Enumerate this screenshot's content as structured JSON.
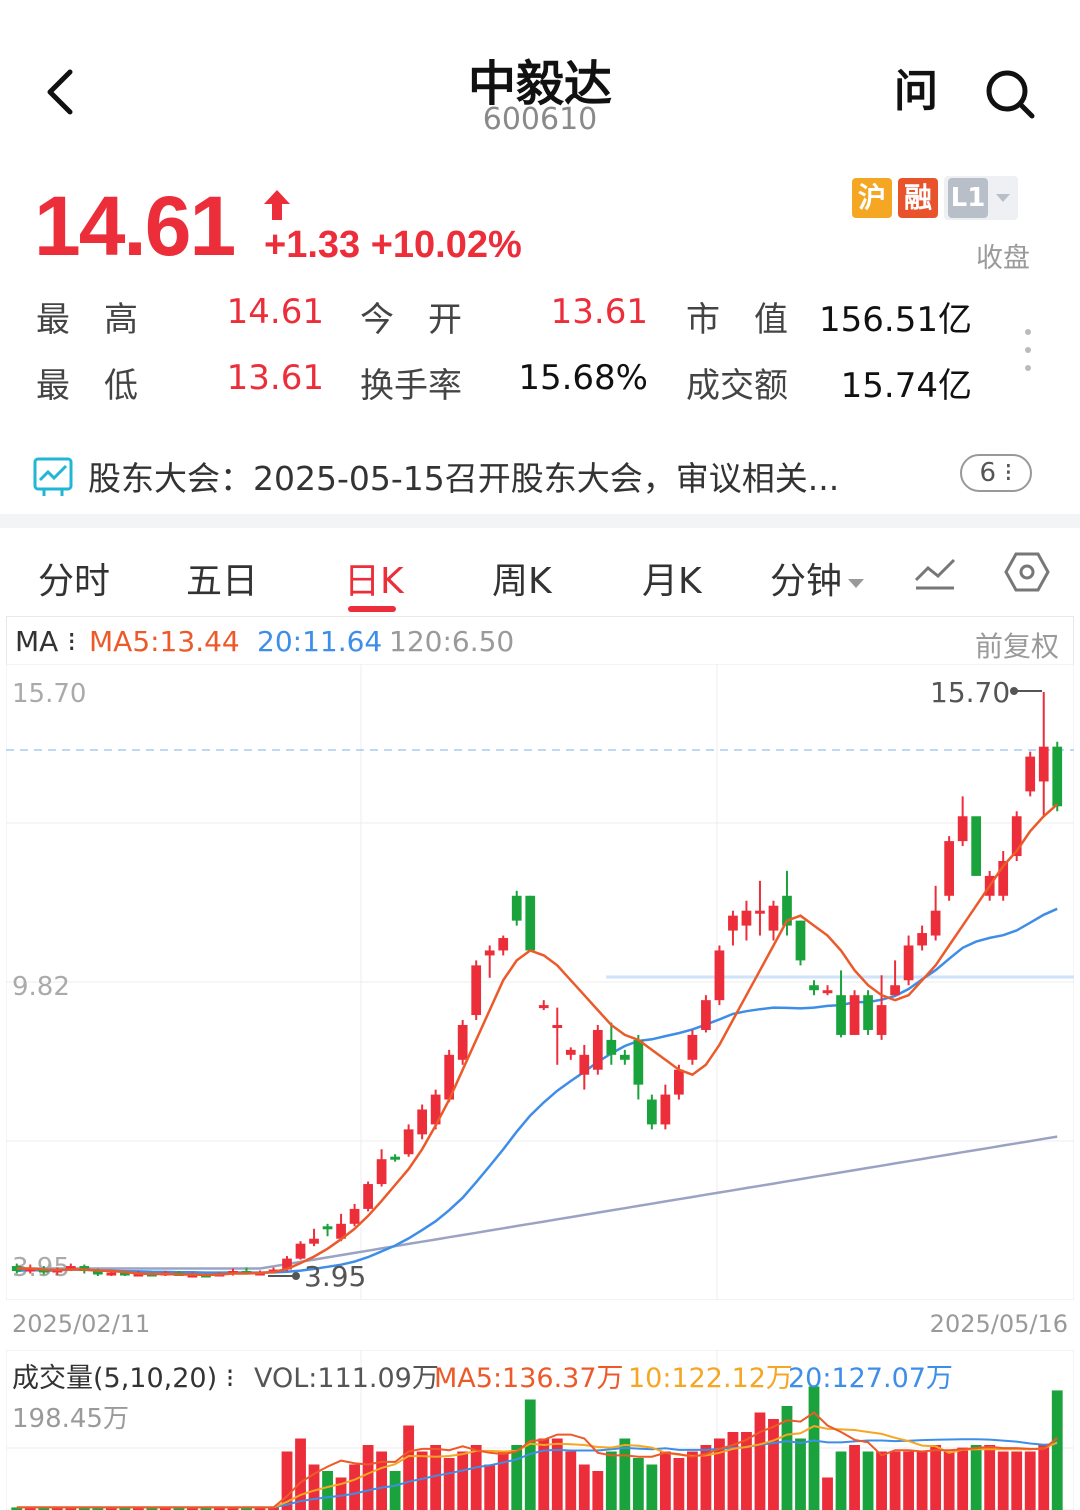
{
  "header": {
    "title": "中毅达",
    "code": "600610",
    "ask_label": "问"
  },
  "quote": {
    "price": "14.61",
    "change": "+1.33 +10.02%",
    "status": "收盘",
    "badges": {
      "hu": "沪",
      "rong": "融",
      "l1": "L1"
    },
    "stats": {
      "high_label": "最　高",
      "high_value": "14.61",
      "open_label": "今　开",
      "open_value": "13.61",
      "mcap_label": "市　值",
      "mcap_value": "156.51亿",
      "low_label": "最　低",
      "low_value": "13.61",
      "turnover_label": "换手率",
      "turnover_value": "15.68%",
      "amount_label": "成交额",
      "amount_value": "15.74亿"
    }
  },
  "notice": {
    "text": "股东大会：2025-05-15召开股东大会，审议相关...",
    "count": "6"
  },
  "tabs": [
    {
      "label": "分时"
    },
    {
      "label": "五日"
    },
    {
      "label": "日K"
    },
    {
      "label": "周K"
    },
    {
      "label": "月K"
    },
    {
      "label": "分钟"
    }
  ],
  "ma_bar": {
    "prefix": "MA",
    "ma5": "MA5:13.44",
    "ma20": "20:11.64",
    "ma120": "120:6.50",
    "adjust": "前复权"
  },
  "colors": {
    "up": "#ec2d3a",
    "down": "#1aa33c",
    "ma5": "#ec5a2a",
    "ma20": "#3e8ee8",
    "ma120": "#9aa3c4",
    "vol10": "#f5a623"
  },
  "chart_data": {
    "type": "candlestick",
    "y_axis_labels": [
      "15.70",
      "9.82",
      "3.95"
    ],
    "ylim": [
      3.95,
      15.7
    ],
    "max_annotation": "15.70",
    "min_annotation": "3.95",
    "x_start": "2025/02/11",
    "x_end": "2025/05/16",
    "candles": [
      [
        4.15,
        4.05,
        4.2,
        4.0
      ],
      [
        4.05,
        4.1,
        4.18,
        4.0
      ],
      [
        4.1,
        4.02,
        4.15,
        3.98
      ],
      [
        4.02,
        4.08,
        4.12,
        3.97
      ],
      [
        4.08,
        4.15,
        4.2,
        4.05
      ],
      [
        4.15,
        4.05,
        4.18,
        4.0
      ],
      [
        4.05,
        3.98,
        4.1,
        3.95
      ],
      [
        3.98,
        4.02,
        4.08,
        3.95
      ],
      [
        4.02,
        3.97,
        4.05,
        3.95
      ],
      [
        3.97,
        4.0,
        4.05,
        3.95
      ],
      [
        4.0,
        3.96,
        4.02,
        3.95
      ],
      [
        3.96,
        4.02,
        4.05,
        3.95
      ],
      [
        4.02,
        3.95,
        4.05,
        3.95
      ],
      [
        3.95,
        3.98,
        4.02,
        3.95
      ],
      [
        3.98,
        3.96,
        4.0,
        3.95
      ],
      [
        3.96,
        4.0,
        4.02,
        3.95
      ],
      [
        4.0,
        4.05,
        4.1,
        3.96
      ],
      [
        4.05,
        4.0,
        4.12,
        3.98
      ],
      [
        4.0,
        4.02,
        4.06,
        3.97
      ],
      [
        4.02,
        4.08,
        4.12,
        4.0
      ],
      [
        4.08,
        4.3,
        4.35,
        4.05
      ],
      [
        4.3,
        4.6,
        4.65,
        4.28
      ],
      [
        4.6,
        4.7,
        4.9,
        4.55
      ],
      [
        4.95,
        4.9,
        5.0,
        4.75
      ],
      [
        4.7,
        5.0,
        5.2,
        4.65
      ],
      [
        5.0,
        5.3,
        5.4,
        4.95
      ],
      [
        5.3,
        5.8,
        5.85,
        5.25
      ],
      [
        5.8,
        6.3,
        6.5,
        5.75
      ],
      [
        6.35,
        6.3,
        6.4,
        6.25
      ],
      [
        6.4,
        6.9,
        7.0,
        6.35
      ],
      [
        6.8,
        7.3,
        7.4,
        6.7
      ],
      [
        7.0,
        7.6,
        7.7,
        6.9
      ],
      [
        7.5,
        8.4,
        8.5,
        7.45
      ],
      [
        8.3,
        9.0,
        9.1,
        8.2
      ],
      [
        9.2,
        10.2,
        10.3,
        9.1
      ],
      [
        10.4,
        10.5,
        10.6,
        9.95
      ],
      [
        10.5,
        10.75,
        10.8,
        10.4
      ],
      [
        11.6,
        11.1,
        11.7,
        11.0
      ],
      [
        11.6,
        10.5,
        11.6,
        10.5
      ],
      [
        9.4,
        9.4,
        9.5,
        9.3
      ],
      [
        9.0,
        9.0,
        9.35,
        8.2
      ],
      [
        8.4,
        8.5,
        8.55,
        8.3
      ],
      [
        8.0,
        8.4,
        8.6,
        7.7
      ],
      [
        8.1,
        8.9,
        9.0,
        8.0
      ],
      [
        8.7,
        8.4,
        9.05,
        8.2
      ],
      [
        8.4,
        8.3,
        8.5,
        8.2
      ],
      [
        8.7,
        7.8,
        8.8,
        7.5
      ],
      [
        7.5,
        7.0,
        7.6,
        6.9
      ],
      [
        7.0,
        7.6,
        7.8,
        6.9
      ],
      [
        7.6,
        8.1,
        8.2,
        7.5
      ],
      [
        8.3,
        8.8,
        8.9,
        8.2
      ],
      [
        8.9,
        9.5,
        9.6,
        8.85
      ],
      [
        9.5,
        10.5,
        10.6,
        9.4
      ],
      [
        10.9,
        11.2,
        11.3,
        10.6
      ],
      [
        11.0,
        11.3,
        11.5,
        10.7
      ],
      [
        11.3,
        11.3,
        11.9,
        10.8
      ],
      [
        10.9,
        11.4,
        11.5,
        10.7
      ],
      [
        11.6,
        11.0,
        12.1,
        10.8
      ],
      [
        11.1,
        10.3,
        11.1,
        10.2
      ],
      [
        9.8,
        9.7,
        9.9,
        9.6
      ],
      [
        9.7,
        9.7,
        9.8,
        9.6
      ],
      [
        9.6,
        8.8,
        10.1,
        8.75
      ],
      [
        8.8,
        9.6,
        9.7,
        8.8
      ],
      [
        9.6,
        8.9,
        9.7,
        8.8
      ],
      [
        8.8,
        9.4,
        10.0,
        8.7
      ],
      [
        9.6,
        9.8,
        10.3,
        9.6
      ],
      [
        9.9,
        10.6,
        10.8,
        9.8
      ],
      [
        10.6,
        10.85,
        11.0,
        10.5
      ],
      [
        10.8,
        11.3,
        11.8,
        10.7
      ],
      [
        11.6,
        12.7,
        12.8,
        11.5
      ],
      [
        12.7,
        13.2,
        13.6,
        12.6
      ],
      [
        13.2,
        12.0,
        12.6,
        12.0
      ],
      [
        11.6,
        12.0,
        12.1,
        11.5
      ],
      [
        11.6,
        12.3,
        12.5,
        11.5
      ],
      [
        12.4,
        13.2,
        13.3,
        12.3
      ],
      [
        13.7,
        14.4,
        14.5,
        13.6
      ],
      [
        13.9,
        14.6,
        15.7,
        13.2
      ],
      [
        14.6,
        13.4,
        14.7,
        13.3
      ]
    ],
    "ma5": [
      4.1,
      4.1,
      4.08,
      4.07,
      4.08,
      4.08,
      4.06,
      4.05,
      4.03,
      4.0,
      3.99,
      3.99,
      3.98,
      3.98,
      3.97,
      3.98,
      4.0,
      4.0,
      4.01,
      4.03,
      4.09,
      4.21,
      4.34,
      4.5,
      4.69,
      4.9,
      5.16,
      5.46,
      5.78,
      6.1,
      6.5,
      6.98,
      7.5,
      8.1,
      8.7,
      9.3,
      9.9,
      10.3,
      10.5,
      10.4,
      10.2,
      9.9,
      9.6,
      9.3,
      9.0,
      8.8,
      8.7,
      8.5,
      8.3,
      8.1,
      8.0,
      8.2,
      8.6,
      9.1,
      9.6,
      10.1,
      10.6,
      11.1,
      11.2,
      11.0,
      10.8,
      10.5,
      10.1,
      9.8,
      9.6,
      9.5,
      9.6,
      9.9,
      10.2,
      10.6,
      11.0,
      11.4,
      11.8,
      12.2,
      12.5,
      12.9,
      13.2,
      13.44
    ]
  },
  "volume": {
    "title": "成交量(5,10,20)",
    "vol": "VOL:111.09万",
    "ma5": "MA5:136.37万",
    "ma10": "10:122.12万",
    "ma20": "20:127.07万",
    "max": "198.45万"
  }
}
